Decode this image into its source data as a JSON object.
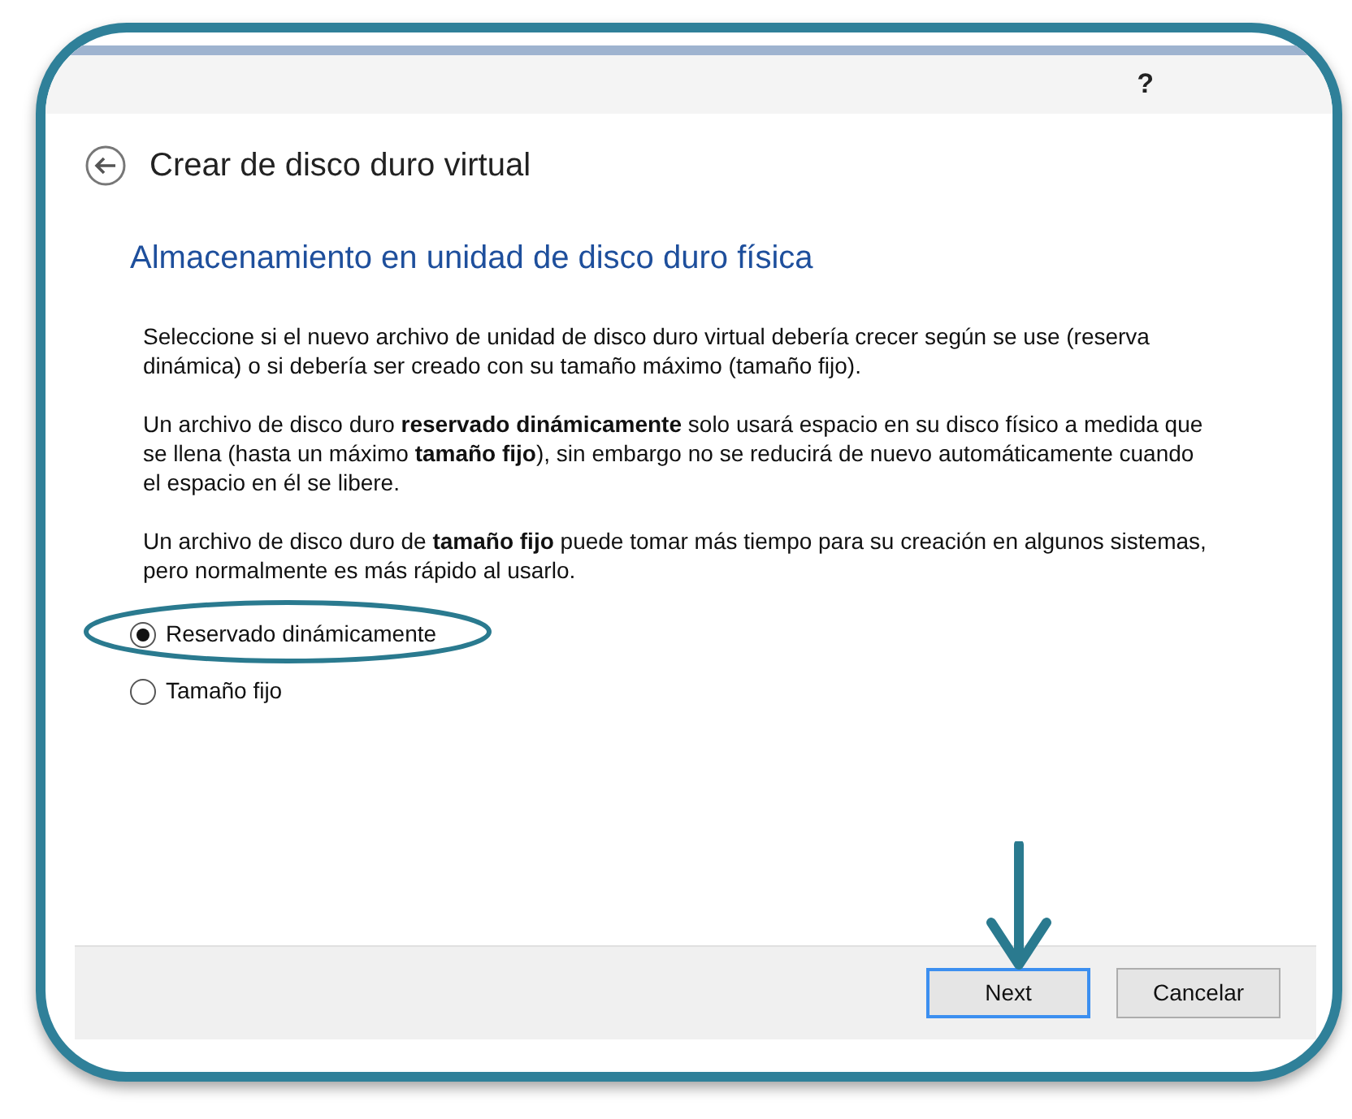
{
  "title_bar": {
    "help": "?"
  },
  "header": {
    "title": "Crear de disco duro virtual"
  },
  "section": {
    "heading": "Almacenamiento en unidad de disco duro física"
  },
  "paragraphs": [
    "Seleccione si el nuevo archivo de unidad de disco duro virtual debería crecer según se use (reserva dinámica) o si debería ser creado con su tamaño máximo (tamaño fijo).",
    "Un archivo de disco duro **reservado dinámicamente** solo usará espacio en su disco físico a medida que se llena (hasta un máximo **tamaño fijo**), sin embargo no se reducirá de nuevo automáticamente cuando el espacio en él se libere.",
    "Un archivo de disco duro de **tamaño fijo** puede tomar más tiempo para su creación en algunos sistemas, pero normalmente es más rápido al usarlo."
  ],
  "options": [
    {
      "label": "Reservado dinámicamente",
      "selected": true
    },
    {
      "label": "Tamaño fijo",
      "selected": false
    }
  ],
  "buttons": [
    {
      "label": "Next",
      "focused": true
    },
    {
      "label": "Cancelar",
      "focused": false
    }
  ]
}
